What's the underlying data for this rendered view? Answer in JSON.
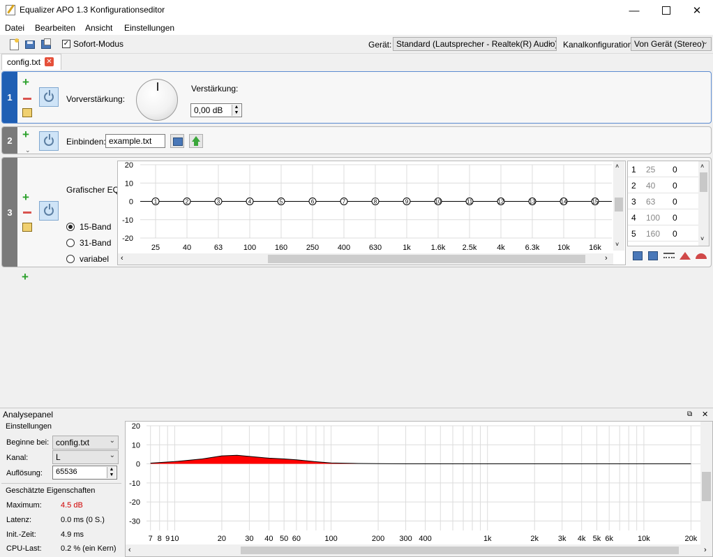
{
  "window": {
    "title": "Equalizer APO 1.3 Konfigurationseditor"
  },
  "menu": [
    "Datei",
    "Bearbeiten",
    "Ansicht",
    "Einstellungen"
  ],
  "toolbar": {
    "instant_mode_label": "Sofort-Modus",
    "instant_mode_checked": true,
    "device_label": "Gerät:",
    "device_value": "Standard (Lautsprecher - Realtek(R) Audio)",
    "channel_label": "Kanalkonfiguration:",
    "channel_value": "Von Gerät (Stereo)"
  },
  "tab": {
    "label": "config.txt"
  },
  "filters": {
    "f1": {
      "number": "1",
      "preamp_label": "Vorverstärkung:",
      "gain_label": "Verstärkung:",
      "gain_value": "0,00 dB"
    },
    "f2": {
      "number": "2",
      "include_label": "Einbinden:",
      "include_value": "example.txt"
    },
    "f3": {
      "number": "3",
      "title": "Grafischer EQ:",
      "band_options": [
        "15-Band",
        "31-Band",
        "variabel"
      ],
      "selected_band": "15-Band",
      "table": [
        {
          "index": "1",
          "freq": "25",
          "gain": "0"
        },
        {
          "index": "2",
          "freq": "40",
          "gain": "0"
        },
        {
          "index": "3",
          "freq": "63",
          "gain": "0"
        },
        {
          "index": "4",
          "freq": "100",
          "gain": "0"
        },
        {
          "index": "5",
          "freq": "160",
          "gain": "0"
        }
      ]
    }
  },
  "analysis": {
    "title": "Analysepanel",
    "settings_label": "Einstellungen",
    "start_label": "Beginne bei:",
    "start_value": "config.txt",
    "channel_label": "Kanal:",
    "channel_value": "L",
    "resolution_label": "Auflösung:",
    "resolution_value": "65536",
    "props_label": "Geschätzte Eigenschaften",
    "maximum_label": "Maximum:",
    "maximum_value": "4.5 dB",
    "latency_label": "Latenz:",
    "latency_value": "0.0 ms (0 S.)",
    "init_label": "Init.-Zeit:",
    "init_value": "4.9 ms",
    "cpu_label": "CPU-Last:",
    "cpu_value": "0.2 % (ein Kern)"
  },
  "colors": {
    "accent_blue": "#1f5fb4",
    "filter_gray": "#7a7a7a",
    "response_fill": "#ff0000",
    "max_value": "#d00000"
  },
  "chart_data": [
    {
      "type": "line",
      "name": "graphic-eq-15-band",
      "categories": [
        "25",
        "40",
        "63",
        "100",
        "160",
        "250",
        "400",
        "630",
        "1k",
        "1.6k",
        "2.5k",
        "4k",
        "6.3k",
        "10k",
        "16k"
      ],
      "points": [
        "1",
        "2",
        "3",
        "4",
        "5",
        "6",
        "7",
        "8",
        "9",
        "10",
        "11",
        "12",
        "13",
        "14",
        "15"
      ],
      "values": [
        0,
        0,
        0,
        0,
        0,
        0,
        0,
        0,
        0,
        0,
        0,
        0,
        0,
        0,
        0
      ],
      "y_ticks": [
        "20",
        "10",
        "0",
        "-10",
        "-20"
      ],
      "ylim": [
        -20,
        20
      ],
      "grid": true
    },
    {
      "type": "area",
      "name": "frequency-response",
      "x": [
        7,
        10,
        15,
        20,
        25,
        30,
        40,
        50,
        60,
        80,
        100,
        150,
        200,
        300,
        500,
        1000,
        5000,
        20000
      ],
      "values": [
        0.4,
        1.2,
        2.6,
        4.2,
        4.5,
        3.9,
        3.0,
        2.6,
        2.1,
        1.1,
        0.5,
        0.2,
        0.1,
        0,
        0,
        0,
        0,
        0
      ],
      "x_tick_labels": [
        "7",
        "8",
        "9",
        "10",
        "20",
        "30",
        "40",
        "50",
        "60",
        "100",
        "200",
        "300",
        "400",
        "1k",
        "2k",
        "3k",
        "4k",
        "5k",
        "6k",
        "10k",
        "20k"
      ],
      "x_ticks": [
        7,
        8,
        9,
        10,
        20,
        30,
        40,
        50,
        60,
        100,
        200,
        300,
        400,
        1000,
        2000,
        3000,
        4000,
        5000,
        6000,
        10000,
        20000
      ],
      "y_ticks": [
        "20",
        "10",
        "0",
        "-10",
        "-20",
        "-30"
      ],
      "ylim": [
        -35,
        20
      ],
      "xscale": "log",
      "grid": true
    }
  ]
}
